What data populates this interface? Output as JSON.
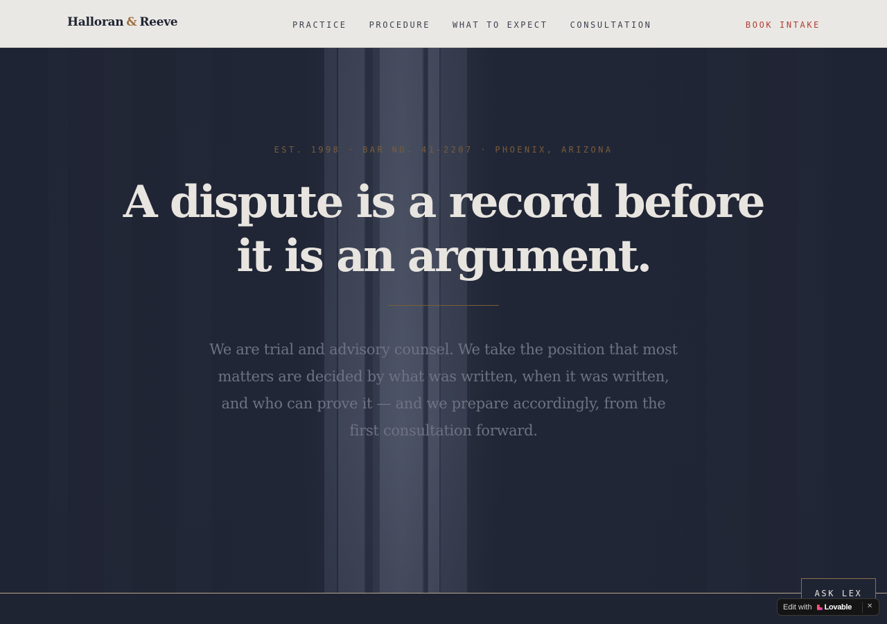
{
  "header": {
    "logo": {
      "first": "Halloran",
      "amp": "&",
      "second": "Reeve"
    },
    "nav": {
      "practice": "PRACTICE",
      "procedure": "PROCEDURE",
      "what_to_expect": "WHAT TO EXPECT",
      "consultation": "CONSULTATION"
    },
    "book_intake": "BOOK INTAKE"
  },
  "hero": {
    "eyebrow": "EST. 1998 · BAR NO. 41-2207 · PHOENIX, ARIZONA",
    "headline_line1": "A dispute is a record before",
    "headline_line2": "it is an argument.",
    "lede": "We are trial and advisory counsel. We take the position that most matters are decided by what was written, when it was written, and who can prove it — and we prepare accordingly, from the first consultation forward."
  },
  "chat": {
    "ask_lex": "ASK LEX"
  },
  "lovable_badge": {
    "edit_with": "Edit with",
    "brand": "Lovable",
    "close": "✕"
  },
  "colors": {
    "navy": "#1f2433",
    "cream": "#eae8e4",
    "accent_bronze": "#9a6d3e",
    "accent_red": "#b23b32",
    "headline": "#e8e4df"
  }
}
